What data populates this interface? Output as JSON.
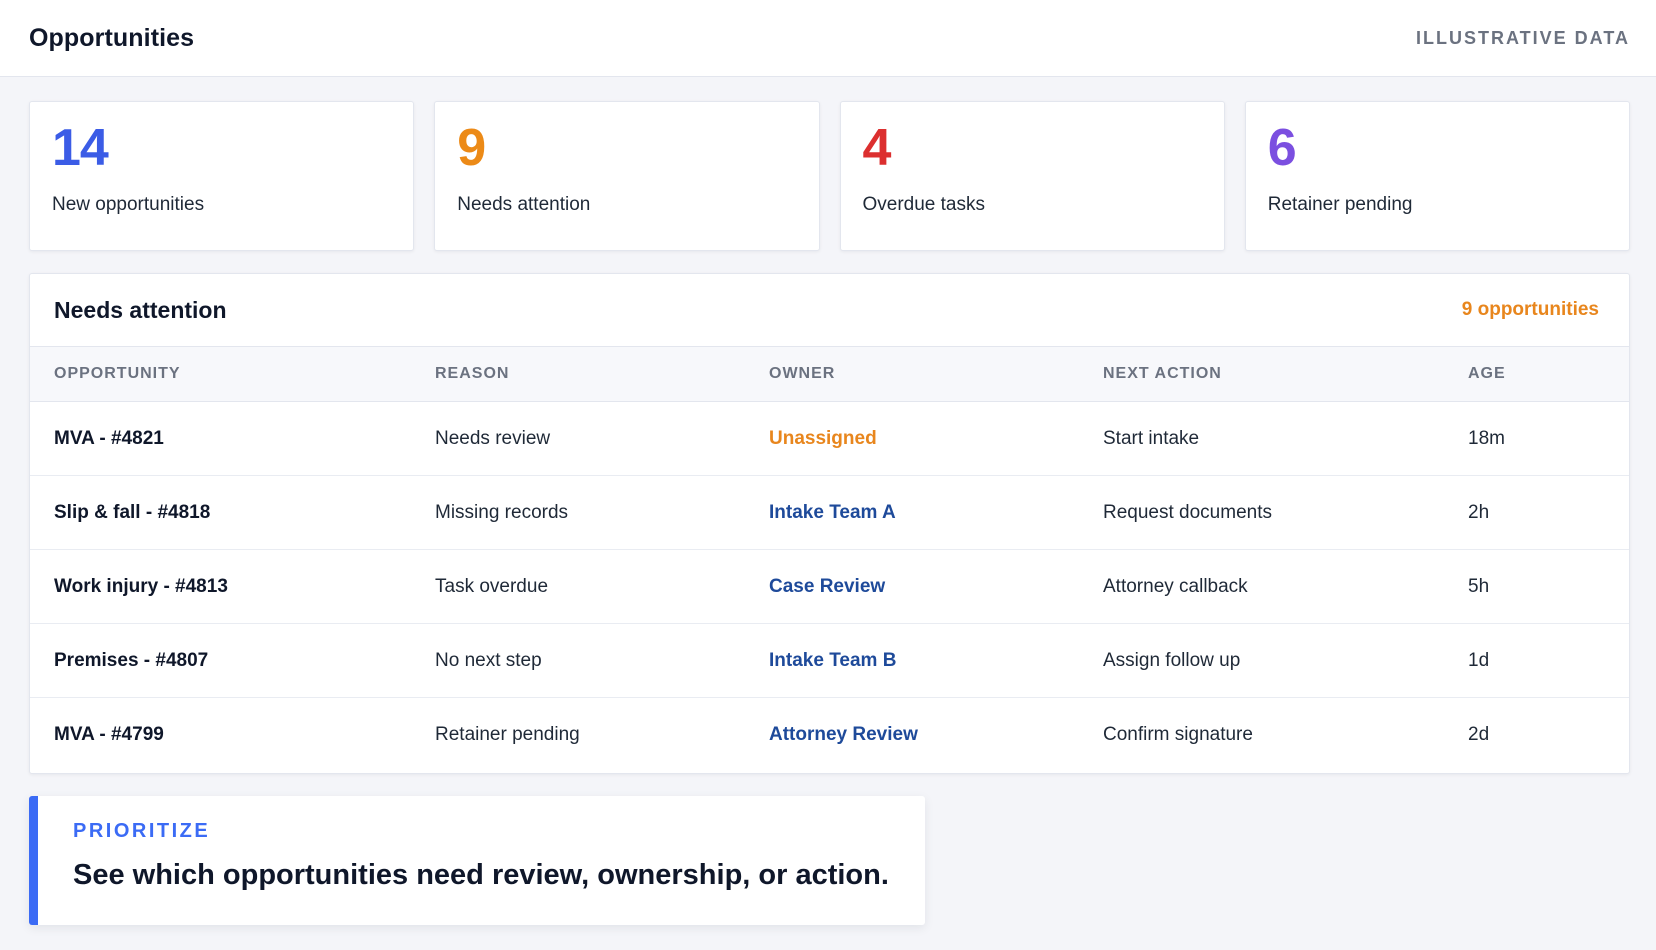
{
  "header": {
    "title": "Opportunities",
    "badge": "ILLUSTRATIVE DATA"
  },
  "stats": [
    {
      "value": "14",
      "label": "New opportunities",
      "color": "#3b5ce6"
    },
    {
      "value": "9",
      "label": "Needs attention",
      "color": "#ec8a17"
    },
    {
      "value": "4",
      "label": "Overdue tasks",
      "color": "#dc2f2f"
    },
    {
      "value": "6",
      "label": "Retainer pending",
      "color": "#7b4fe0"
    }
  ],
  "panel": {
    "title": "Needs attention",
    "count": "9 opportunities",
    "columns": [
      "OPPORTUNITY",
      "REASON",
      "OWNER",
      "NEXT ACTION",
      "AGE"
    ],
    "rows": [
      {
        "opportunity": "MVA - #4821",
        "reason": "Needs review",
        "owner": "Unassigned",
        "next_action": "Start intake",
        "age": "18m"
      },
      {
        "opportunity": "Slip & fall - #4818",
        "reason": "Missing records",
        "owner": "Intake Team A",
        "next_action": "Request documents",
        "age": "2h"
      },
      {
        "opportunity": "Work injury - #4813",
        "reason": "Task overdue",
        "owner": "Case Review",
        "next_action": "Attorney callback",
        "age": "5h"
      },
      {
        "opportunity": "Premises - #4807",
        "reason": "No next step",
        "owner": "Intake Team B",
        "next_action": "Assign follow up",
        "age": "1d"
      },
      {
        "opportunity": "MVA - #4799",
        "reason": "Retainer pending",
        "owner": "Attorney Review",
        "next_action": "Confirm signature",
        "age": "2d"
      }
    ]
  },
  "callout": {
    "kicker": "PRIORITIZE",
    "text": "See which opportunities need review, ownership, or action."
  },
  "colors": {
    "accent": "#3b6bf5",
    "warning": "#e8861d",
    "owner_link": "#1e4a9a"
  }
}
